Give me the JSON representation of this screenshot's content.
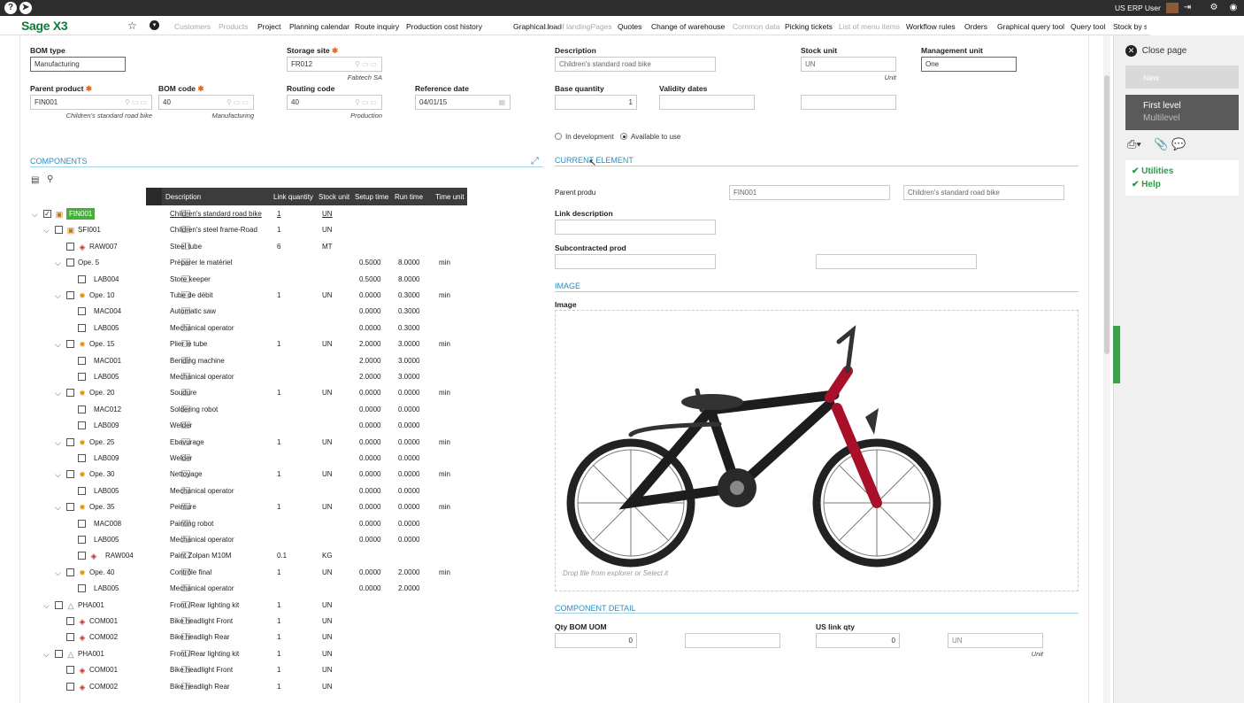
{
  "app": {
    "logo": "Sage X3",
    "user": "US ERP User",
    "help_glyph": "?"
  },
  "nav": [
    {
      "label": "Customers",
      "dim": true
    },
    {
      "label": "Products",
      "dim": true
    },
    {
      "label": "Project",
      "dim": false
    },
    {
      "label": "Planning calendar",
      "dim": false
    },
    {
      "label": "Route inquiry",
      "dim": false
    },
    {
      "label": "Production cost history",
      "dim": false
    },
    {
      "label": "Graphical load",
      "dim": false
    },
    {
      "label": "List of landingPages",
      "dim": true
    },
    {
      "label": "Quotes",
      "dim": false
    },
    {
      "label": "Change of warehouse",
      "dim": false
    },
    {
      "label": "Common data",
      "dim": true
    },
    {
      "label": "Picking tickets",
      "dim": false
    },
    {
      "label": "List of menu items",
      "dim": true
    },
    {
      "label": "Workflow rules",
      "dim": false
    },
    {
      "label": "Orders",
      "dim": false
    },
    {
      "label": "Graphical query tool",
      "dim": false
    },
    {
      "label": "Query tool",
      "dim": false
    },
    {
      "label": "Stock by s",
      "dim": false
    }
  ],
  "header": {
    "bom_type_label": "BOM type",
    "bom_type": "Manufacturing",
    "storage_site_label": "Storage site",
    "storage_site": "FR012",
    "storage_site_sub": "Fabtech SA",
    "description_label": "Description",
    "description": "Children's standard road bike",
    "stock_unit_label": "Stock unit",
    "stock_unit": "UN",
    "stock_unit_sub": "Unit",
    "mgmt_unit_label": "Management unit",
    "mgmt_unit": "One",
    "parent_product_label": "Parent product",
    "parent_product": "FIN001",
    "parent_product_sub": "Children's standard road bike",
    "bom_code_label": "BOM code",
    "bom_code": "40",
    "bom_code_sub": "Manufacturing",
    "routing_code_label": "Routing code",
    "routing_code": "40",
    "routing_code_sub": "Production",
    "reference_date_label": "Reference date",
    "reference_date": "04/01/15",
    "base_qty_label": "Base quantity",
    "base_qty": "1",
    "validity_label": "Validity dates",
    "radio_dev": "In development",
    "radio_avail": "Available to use"
  },
  "components": {
    "title": "COMPONENTS",
    "columns": [
      "Description",
      "Link quantity",
      "Stock unit",
      "Setup time",
      "Run time",
      "Time unit"
    ],
    "rows": [
      {
        "code": "FIN001",
        "desc": "Children's standard road bike",
        "qty": "1",
        "unit": "UN",
        "setup": "",
        "run": "",
        "tunit": "",
        "level": 0,
        "icon": "box",
        "chev": true,
        "checked": true,
        "selected": true,
        "link": true
      },
      {
        "code": "SFI001",
        "desc": "Children's steel frame-Road",
        "qty": "1",
        "unit": "UN",
        "setup": "",
        "run": "",
        "tunit": "",
        "level": 1,
        "icon": "box",
        "chev": true
      },
      {
        "code": "RAW007",
        "desc": "Steel tube",
        "qty": "6",
        "unit": "MT",
        "setup": "",
        "run": "",
        "tunit": "",
        "level": 2,
        "icon": "part"
      },
      {
        "code": "Ope. 5",
        "desc": "Préparer le matériel",
        "qty": "",
        "unit": "",
        "setup": "0.5000",
        "run": "8.0000",
        "tunit": "min",
        "level": 2,
        "icon": "",
        "chev": true
      },
      {
        "code": "LAB004",
        "desc": "Store keeper",
        "qty": "",
        "unit": "",
        "setup": "0.5000",
        "run": "8.0000",
        "tunit": "",
        "level": 3,
        "icon": ""
      },
      {
        "code": "Ope. 10",
        "desc": "Tube de débit",
        "qty": "1",
        "unit": "UN",
        "setup": "0.0000",
        "run": "0.3000",
        "tunit": "min",
        "level": 2,
        "icon": "gear",
        "chev": true
      },
      {
        "code": "MAC004",
        "desc": "Automatic saw",
        "qty": "",
        "unit": "",
        "setup": "0.0000",
        "run": "0.3000",
        "tunit": "",
        "level": 3,
        "icon": ""
      },
      {
        "code": "LAB005",
        "desc": "Mechanical operator",
        "qty": "",
        "unit": "",
        "setup": "0.0000",
        "run": "0.3000",
        "tunit": "",
        "level": 3,
        "icon": ""
      },
      {
        "code": "Ope. 15",
        "desc": "Plier le tube",
        "qty": "1",
        "unit": "UN",
        "setup": "2.0000",
        "run": "3.0000",
        "tunit": "min",
        "level": 2,
        "icon": "gear",
        "chev": true
      },
      {
        "code": "MAC001",
        "desc": "Bending machine",
        "qty": "",
        "unit": "",
        "setup": "2.0000",
        "run": "3.0000",
        "tunit": "",
        "level": 3,
        "icon": ""
      },
      {
        "code": "LAB005",
        "desc": "Mechanical operator",
        "qty": "",
        "unit": "",
        "setup": "2.0000",
        "run": "3.0000",
        "tunit": "",
        "level": 3,
        "icon": ""
      },
      {
        "code": "Ope. 20",
        "desc": "Soudure",
        "qty": "1",
        "unit": "UN",
        "setup": "0.0000",
        "run": "0.0000",
        "tunit": "min",
        "level": 2,
        "icon": "gear",
        "chev": true
      },
      {
        "code": "MAC012",
        "desc": "Soldering robot",
        "qty": "",
        "unit": "",
        "setup": "0.0000",
        "run": "0.0000",
        "tunit": "",
        "level": 3,
        "icon": ""
      },
      {
        "code": "LAB009",
        "desc": "Welder",
        "qty": "",
        "unit": "",
        "setup": "0.0000",
        "run": "0.0000",
        "tunit": "",
        "level": 3,
        "icon": ""
      },
      {
        "code": "Ope. 25",
        "desc": "Ebavurage",
        "qty": "1",
        "unit": "UN",
        "setup": "0.0000",
        "run": "0.0000",
        "tunit": "min",
        "level": 2,
        "icon": "gear",
        "chev": true
      },
      {
        "code": "LAB009",
        "desc": "Welder",
        "qty": "",
        "unit": "",
        "setup": "0.0000",
        "run": "0.0000",
        "tunit": "",
        "level": 3,
        "icon": ""
      },
      {
        "code": "Ope. 30",
        "desc": "Nettoyage",
        "qty": "1",
        "unit": "UN",
        "setup": "0.0000",
        "run": "0.0000",
        "tunit": "min",
        "level": 2,
        "icon": "gear",
        "chev": true
      },
      {
        "code": "LAB005",
        "desc": "Mechanical operator",
        "qty": "",
        "unit": "",
        "setup": "0.0000",
        "run": "0.0000",
        "tunit": "",
        "level": 3,
        "icon": ""
      },
      {
        "code": "Ope. 35",
        "desc": "Peinture",
        "qty": "1",
        "unit": "UN",
        "setup": "0.0000",
        "run": "0.0000",
        "tunit": "min",
        "level": 2,
        "icon": "gear",
        "chev": true
      },
      {
        "code": "MAC008",
        "desc": "Painting robot",
        "qty": "",
        "unit": "",
        "setup": "0.0000",
        "run": "0.0000",
        "tunit": "",
        "level": 3,
        "icon": ""
      },
      {
        "code": "LAB005",
        "desc": "Mechanical operator",
        "qty": "",
        "unit": "",
        "setup": "0.0000",
        "run": "0.0000",
        "tunit": "",
        "level": 3,
        "icon": ""
      },
      {
        "code": "RAW004",
        "desc": "Paint Zolpan M10M",
        "qty": "0.1",
        "unit": "KG",
        "setup": "",
        "run": "",
        "tunit": "",
        "level": 3,
        "icon": "part"
      },
      {
        "code": "Ope. 40",
        "desc": "Contrôle final",
        "qty": "1",
        "unit": "UN",
        "setup": "0.0000",
        "run": "2.0000",
        "tunit": "min",
        "level": 2,
        "icon": "gear",
        "chev": true
      },
      {
        "code": "LAB005",
        "desc": "Mechanical operator",
        "qty": "",
        "unit": "",
        "setup": "0.0000",
        "run": "2.0000",
        "tunit": "",
        "level": 3,
        "icon": ""
      },
      {
        "code": "PHA001",
        "desc": "Front /Rear lighting kit",
        "qty": "1",
        "unit": "UN",
        "setup": "",
        "run": "",
        "tunit": "",
        "level": 1,
        "icon": "kit",
        "chev": true
      },
      {
        "code": "COM001",
        "desc": "Bike headlight Front",
        "qty": "1",
        "unit": "UN",
        "setup": "",
        "run": "",
        "tunit": "",
        "level": 2,
        "icon": "part"
      },
      {
        "code": "COM002",
        "desc": "Bike headligh Rear",
        "qty": "1",
        "unit": "UN",
        "setup": "",
        "run": "",
        "tunit": "",
        "level": 2,
        "icon": "part"
      },
      {
        "code": "PHA001",
        "desc": "Front /Rear lighting kit",
        "qty": "1",
        "unit": "UN",
        "setup": "",
        "run": "",
        "tunit": "",
        "level": 1,
        "icon": "kit",
        "chev": true
      },
      {
        "code": "COM001",
        "desc": "Bike headlight Front",
        "qty": "1",
        "unit": "UN",
        "setup": "",
        "run": "",
        "tunit": "",
        "level": 2,
        "icon": "part"
      },
      {
        "code": "COM002",
        "desc": "Bike headligh Rear",
        "qty": "1",
        "unit": "UN",
        "setup": "",
        "run": "",
        "tunit": "",
        "level": 2,
        "icon": "part"
      }
    ]
  },
  "current": {
    "title": "CURRENT ELEMENT",
    "parent_label": "Parent produ",
    "parent_code": "FIN001",
    "parent_desc": "Children's standard road bike",
    "link_desc_label": "Link description",
    "subcontract_label": "Subcontracted prod"
  },
  "image": {
    "title": "IMAGE",
    "label": "Image",
    "drop_hint": "Drop file from explorer or Select it"
  },
  "component_detail": {
    "title": "COMPONENT DETAIL",
    "qty_label": "Qty BOM UOM",
    "qty": "0",
    "us_label": "US link qty",
    "us_qty": "0",
    "us_unit": "UN",
    "us_unit_sub": "Unit"
  },
  "sidebar": {
    "close": "Close page",
    "new": "New",
    "level1": "First level",
    "level2": "Multilevel",
    "utilities": "Utilities",
    "help": "Help"
  },
  "colors": {
    "accent": "#2a8fbd",
    "brand": "#0a7d3a",
    "selected_node": "#44b035",
    "tab": "#3aa34a"
  }
}
